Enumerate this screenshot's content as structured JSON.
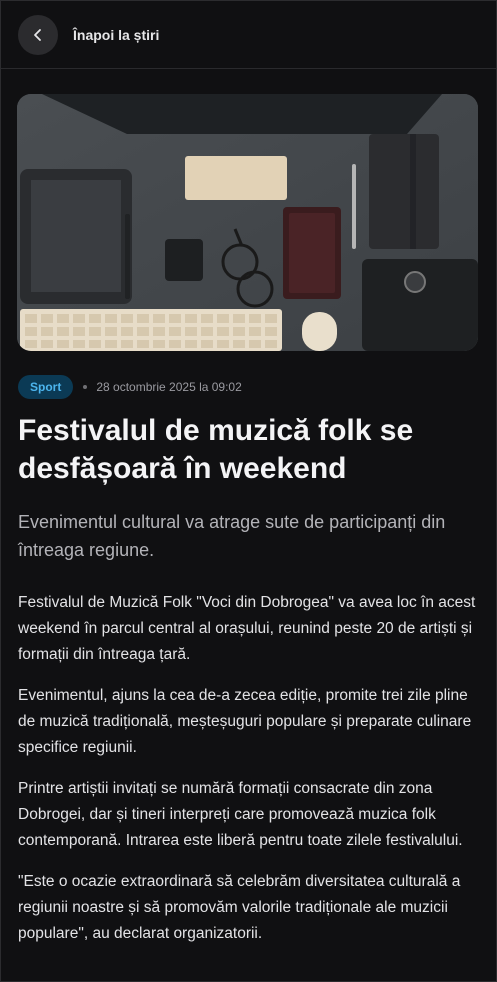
{
  "header": {
    "back_label": "Înapoi la știri",
    "back_icon": "chevron-left-icon"
  },
  "article": {
    "category": "Sport",
    "date": "28 octombrie 2025 la 09:02",
    "title": "Festivalul de muzică folk se desfășoară în weekend",
    "subtitle": "Evenimentul cultural va atrage sute de participanți din întreaga regiune.",
    "paragraphs": [
      "Festivalul de Muzică Folk \"Voci din Dobrogea\" va avea loc în acest weekend în parcul central al orașului, reunind peste 20 de artiști și formații din întreaga țară.",
      "Evenimentul, ajuns la cea de-a zecea ediție, promite trei zile pline de muzică tradițională, meșteșuguri populare și preparate culinare specifice regiunii.",
      "Printre artiștii invitați se numără formații consacrate din zona Dobrogei, dar și tineri interpreți care promovează muzica folk contemporană. Intrarea este liberă pentru toate zilele festivalului.",
      "\"Este o ocazie extraordinară să celebrăm diversitatea culturală a regiunii noastre și să promovăm valorile tradiționale ale muzicii populare\", au declarat organizatorii."
    ]
  },
  "colors": {
    "background": "#101012",
    "badge_bg": "#0b3a55",
    "badge_text": "#4cb5ee",
    "title": "#f4f4f6",
    "subtitle": "#b3b3b8",
    "body_text": "#e3e3e6"
  }
}
